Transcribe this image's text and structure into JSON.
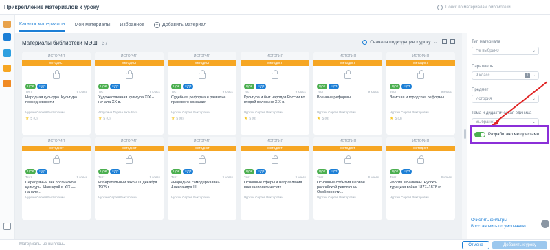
{
  "window": {
    "title": "Прикрепление материалов к уроку",
    "search_placeholder": "Поиск по материалам библиотеки..."
  },
  "tabs": [
    {
      "label": "Каталог материалов",
      "active": true
    },
    {
      "label": "Мои материалы",
      "active": false
    },
    {
      "label": "Избранное",
      "active": false
    },
    {
      "label": "Добавить материал",
      "active": false
    }
  ],
  "library": {
    "title": "Материалы библиотеки МЭШ",
    "count": "37",
    "sort_label": "Сначала подходящие к уроку"
  },
  "card_common": {
    "subject": "ИСТОРИЯ",
    "ribbon": "методист",
    "tag_green": "ЦОК",
    "tag_blue": "ЦДЗ",
    "type": "Тест",
    "grade": "9 класс"
  },
  "cards": [
    {
      "title": "Народная культура. Культура повседневности",
      "author": "Чурсин Сергей Викторович",
      "rating": "5 (0)"
    },
    {
      "title": "Художественная культура XIX – начала XX в.",
      "author": "Абдулина Тереза Ахтыбеко...",
      "rating": "5 (0)"
    },
    {
      "title": "Судебная реформа и развитие правового сознания",
      "author": "Чурсин Сергей Викторович",
      "rating": "5 (0)"
    },
    {
      "title": "Культура и быт народов России во второй половине XIX в.",
      "author": "Чурсин Сергей Викторович",
      "rating": "5 (0)"
    },
    {
      "title": "Военные реформы",
      "author": "Чурсин Сергей Викторович",
      "rating": "5 (0)"
    },
    {
      "title": "Земская и городская реформы",
      "author": "Чурсин Сергей Викторович",
      "rating": "5 (0)"
    },
    {
      "title": "Серебряный век российской культуры. Наш край в XIX — начале...",
      "author": "Чурсин Сергей Викторович",
      "rating": ""
    },
    {
      "title": "Избирательный закон 11 декабря 1905 г.",
      "author": "Чурсин Сергей Викторович",
      "rating": ""
    },
    {
      "title": "«Народное самодержавие» Александра III",
      "author": "Чурсин Сергей Викторович",
      "rating": ""
    },
    {
      "title": "Основные сферы и направления внешнеполитических...",
      "author": "Чурсин Сергей Викторович",
      "rating": ""
    },
    {
      "title": "Основные события Первой российской революции. Особенности...",
      "author": "Чурсин Сергей Викторович",
      "rating": ""
    },
    {
      "title": "Россия и Балканы. Русско-турецкая война 1877–1878 гг.",
      "author": "Чурсин Сергей Викторович",
      "rating": ""
    }
  ],
  "filters": {
    "type_label": "Тип материала",
    "type_value": "Не выбрано",
    "parallel_label": "Параллель",
    "parallel_value": "9 класс",
    "parallel_badge": "1",
    "subject_label": "Предмет",
    "subject_value": "История",
    "topic_label": "Тема и дидактическая единица",
    "topic_value": "Выбрано: 1",
    "methodist_label": "Разработано методистами",
    "methodist_on": true,
    "clear_link": "Очистить фильтры",
    "restore_link": "Восстановить по умолчанию"
  },
  "footer": {
    "info": "Материалы не выбраны",
    "cancel": "Отмена",
    "add": "Добавить к уроку"
  },
  "colors": {
    "accent": "#1c7fd6",
    "ribbon": "#f6a623",
    "highlight_box": "#8b2fd8",
    "arrow": "#e02424",
    "toggle_on": "#4caf50"
  }
}
